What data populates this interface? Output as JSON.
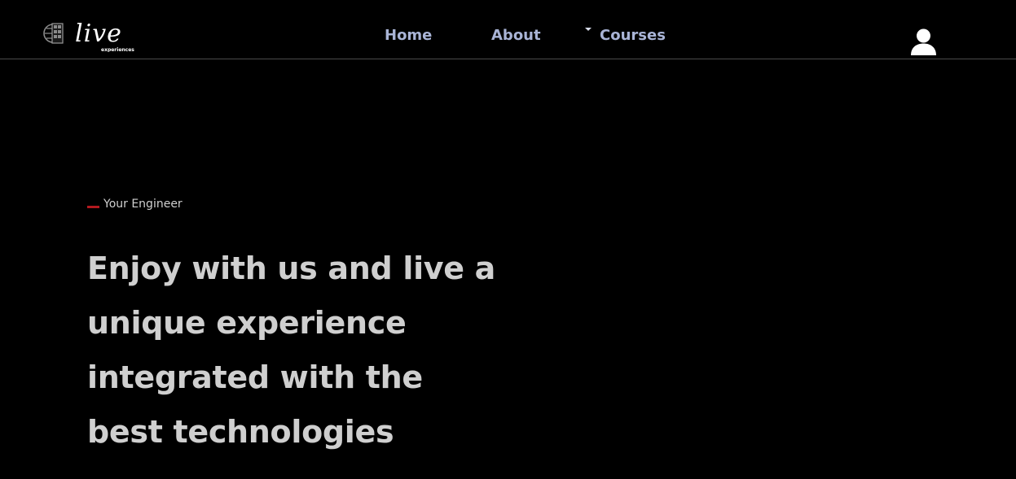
{
  "header": {
    "logo": {
      "icon": "film-slate-globe-icon",
      "word": "live",
      "tagline": "experiences"
    },
    "nav": [
      {
        "label": "Home"
      },
      {
        "label": "About"
      },
      {
        "label": "Courses",
        "has_dropdown": true
      }
    ],
    "user_icon": "user-icon"
  },
  "hero": {
    "eyebrow": "Your Engineer",
    "headline_lines": [
      "Enjoy with us and live a",
      "unique experience",
      "integrated with the",
      "best technologies"
    ]
  },
  "colors": {
    "background": "#000000",
    "nav_link": "#a9b4d6",
    "headline": "#cfcfcf",
    "accent": "#b3191f",
    "divider": "#4a4a4a"
  }
}
